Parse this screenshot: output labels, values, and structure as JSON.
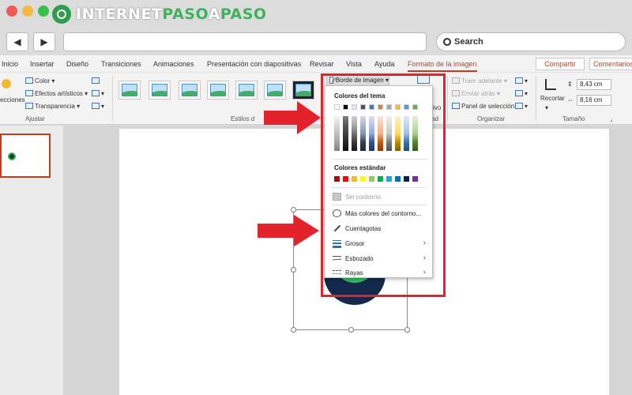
{
  "brand": {
    "prefix": "INTERNET",
    "suffix1": "PASO",
    "mid": "A",
    "suffix2": "PASO"
  },
  "browser": {
    "back_label": "◀",
    "forward_label": "▶",
    "url_value": "",
    "search_label": "Search"
  },
  "tabs": [
    {
      "label": "Inicio"
    },
    {
      "label": "Insertar"
    },
    {
      "label": "Diseño"
    },
    {
      "label": "Transiciones"
    },
    {
      "label": "Animaciones"
    },
    {
      "label": "Presentación con diapositivas"
    },
    {
      "label": "Revisar"
    },
    {
      "label": "Vista"
    },
    {
      "label": "Ayuda"
    },
    {
      "label": "Formato de la imagen"
    }
  ],
  "share_label": "Compartir",
  "comments_label": "Comentarios",
  "ribbon": {
    "correcciones": "ecciones",
    "color": "Color",
    "efectos": "Efectos artísticos",
    "transparencia": "Transparencia",
    "ajustar": "Ajustar",
    "estilos": "Estilos d",
    "borde": "Borde de imagen",
    "traer": "Traer adelante",
    "enviar": "Enviar atrás",
    "panel": "Panel de selección",
    "organizar": "Organizar",
    "recortar": "Recortar",
    "alto": "8,43 cm",
    "ancho": "8,16 cm",
    "tamano": "Tamaño",
    "accesibilidad": "idad",
    "alt": "ivo"
  },
  "menu": {
    "theme_header": "Colores del tema",
    "standard_header": "Colores estándar",
    "no_outline": "Sin contorno",
    "more_colors": "Más colores del contorno...",
    "eyedropper": "Cuentagotas",
    "weight": "Grosor",
    "sketched": "Esbozado",
    "dashes": "Rayas",
    "theme_top": [
      "#ffffff",
      "#000000",
      "#e7e6e6",
      "#44546a",
      "#4472c4",
      "#ed7d31",
      "#a5a5a5",
      "#ffc000",
      "#5b9bd5",
      "#70ad47"
    ],
    "standard": [
      "#c00000",
      "#ff0000",
      "#ffc000",
      "#ffff00",
      "#92d050",
      "#00b050",
      "#00b0f0",
      "#0070c0",
      "#002060",
      "#7030a0"
    ]
  },
  "colors": {
    "accent": "#c43e1c",
    "annotation": "#e3232b",
    "brand_green": "#3eb35b"
  }
}
